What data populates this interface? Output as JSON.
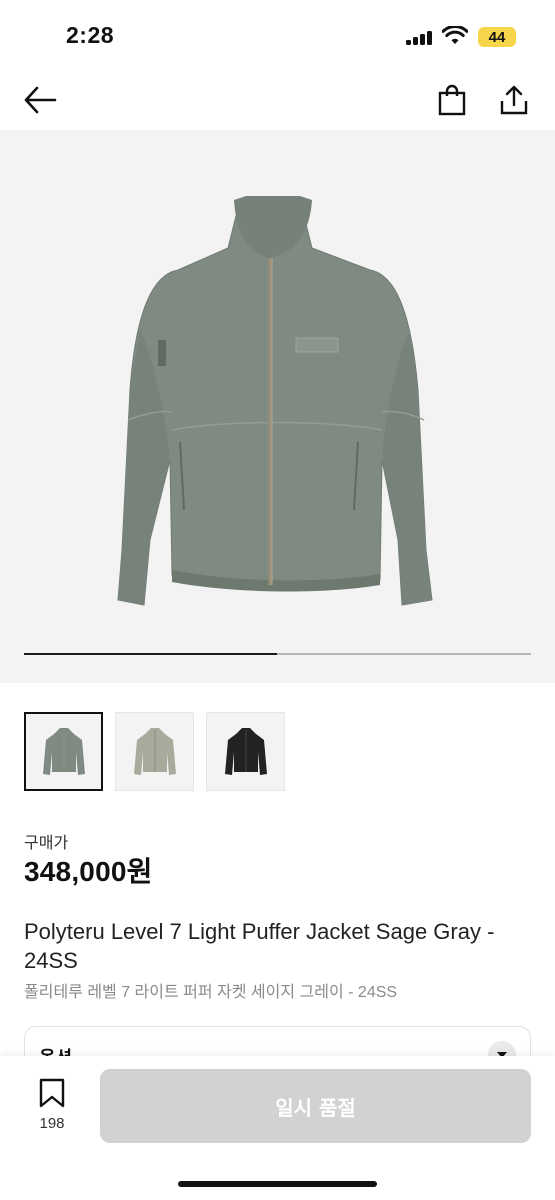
{
  "status_bar": {
    "time": "2:28",
    "battery": "44",
    "battery_color": "#f7d54a"
  },
  "nav": {
    "back_icon": "arrow-left-icon",
    "bag_icon": "shopping-bag-icon",
    "share_icon": "share-icon"
  },
  "gallery": {
    "main_image": "sage-gray-puffer-jacket",
    "progress": 0.5,
    "thumbnails": [
      {
        "color": "sage-gray",
        "selected": true
      },
      {
        "color": "light-sage",
        "selected": false
      },
      {
        "color": "black",
        "selected": false
      }
    ]
  },
  "product": {
    "price_label": "구매가",
    "price": "348,000원",
    "name_en": "Polyteru Level 7 Light Puffer Jacket Sage Gray - 24SS",
    "name_ko": "폴리테루 레벨 7 라이트 퍼퍼 자켓 세이지 그레이 - 24SS"
  },
  "options": {
    "label": "옵션"
  },
  "bottom": {
    "wish_count": "198",
    "buy_button": "일시 품절",
    "button_color": "#d2d2d2"
  }
}
